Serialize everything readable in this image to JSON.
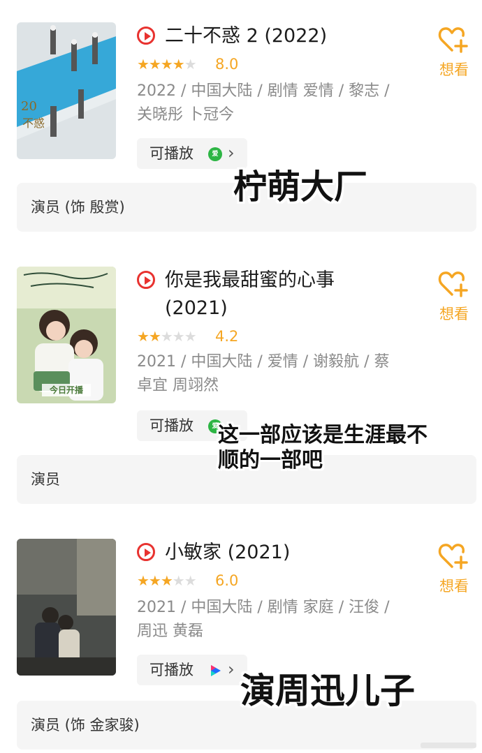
{
  "items": [
    {
      "title": "二十不惑 2 (2022)",
      "rating": 8.0,
      "rating_text": "8.0",
      "stars_filled": 4,
      "meta": "2022 / 中国大陆 / 剧情 爱情 / 黎志 / 关晓彤 卜冠今",
      "play_label": "可播放",
      "platform_icon": "iqiyi-icon",
      "platform_glyph": "爱",
      "want_label": "想看",
      "cast": "演员 (饰 殷赏)",
      "poster_icon": "poster-twenty-your-life",
      "poster_text": ""
    },
    {
      "title": "你是我最甜蜜的心事 (2021)",
      "rating": 4.2,
      "rating_text": "4.2",
      "stars_filled": 2,
      "meta": "2021 / 中国大陆 / 爱情 / 谢毅航 / 蔡卓宜 周翊然",
      "play_label": "可播放",
      "platform_icon": "iqiyi-icon",
      "platform_glyph": "爱",
      "want_label": "想看",
      "cast": "演员",
      "poster_icon": "poster-sweet-heart",
      "poster_text": "今日开播"
    },
    {
      "title": "小敏家 (2021)",
      "rating": 6.0,
      "rating_text": "6.0",
      "stars_filled": 3,
      "meta": "2021 / 中国大陆 / 剧情 家庭 / 汪俊 / 周迅 黄磊",
      "play_label": "可播放",
      "platform_icon": "youku-icon",
      "platform_glyph": "",
      "want_label": "想看",
      "cast": "演员 (饰 金家骏)",
      "poster_icon": "poster-xiaomin-home",
      "poster_text": ""
    }
  ],
  "overlays": {
    "caption_1": "柠萌大厂",
    "caption_2_line1": "这一部应该是生涯最不",
    "caption_2_line2": "顺的一部吧",
    "caption_3": "演周迅儿子"
  },
  "colors": {
    "accent_orange": "#f5a623",
    "play_red": "#e8322f",
    "iqiyi_green": "#2db544"
  }
}
